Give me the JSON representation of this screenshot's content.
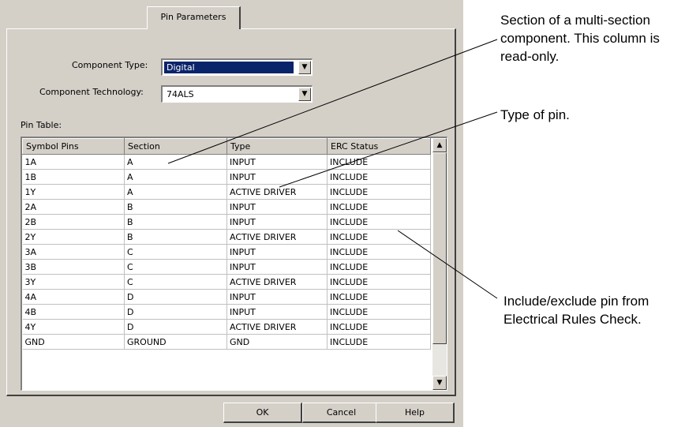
{
  "dialog": {
    "tab_label": "Pin Parameters",
    "component_type_label": "Component Type:",
    "component_type_value": "Digital",
    "component_tech_label": "Component Technology:",
    "component_tech_value": "74ALS",
    "pin_table_label": "Pin Table:",
    "columns": [
      "Symbol Pins",
      "Section",
      "Type",
      "ERC Status"
    ],
    "rows": [
      [
        "1A",
        "A",
        "INPUT",
        "INCLUDE"
      ],
      [
        "1B",
        "A",
        "INPUT",
        "INCLUDE"
      ],
      [
        "1Y",
        "A",
        "ACTIVE DRIVER",
        "INCLUDE"
      ],
      [
        "2A",
        "B",
        "INPUT",
        "INCLUDE"
      ],
      [
        "2B",
        "B",
        "INPUT",
        "INCLUDE"
      ],
      [
        "2Y",
        "B",
        "ACTIVE DRIVER",
        "INCLUDE"
      ],
      [
        "3A",
        "C",
        "INPUT",
        "INCLUDE"
      ],
      [
        "3B",
        "C",
        "INPUT",
        "INCLUDE"
      ],
      [
        "3Y",
        "C",
        "ACTIVE DRIVER",
        "INCLUDE"
      ],
      [
        "4A",
        "D",
        "INPUT",
        "INCLUDE"
      ],
      [
        "4B",
        "D",
        "INPUT",
        "INCLUDE"
      ],
      [
        "4Y",
        "D",
        "ACTIVE DRIVER",
        "INCLUDE"
      ],
      [
        "GND",
        "GROUND",
        "GND",
        "INCLUDE"
      ]
    ],
    "buttons": {
      "ok": "OK",
      "cancel": "Cancel",
      "help": "Help"
    }
  },
  "callouts": {
    "section": [
      "Section of a multi-section",
      "component. This column is",
      "read-only."
    ],
    "type": [
      "Type of pin."
    ],
    "erc": [
      "Include/exclude pin from",
      "Electrical Rules Check."
    ]
  },
  "colors": {
    "dialog_bg": "#d4d0c8",
    "selection": "#0a246a"
  }
}
